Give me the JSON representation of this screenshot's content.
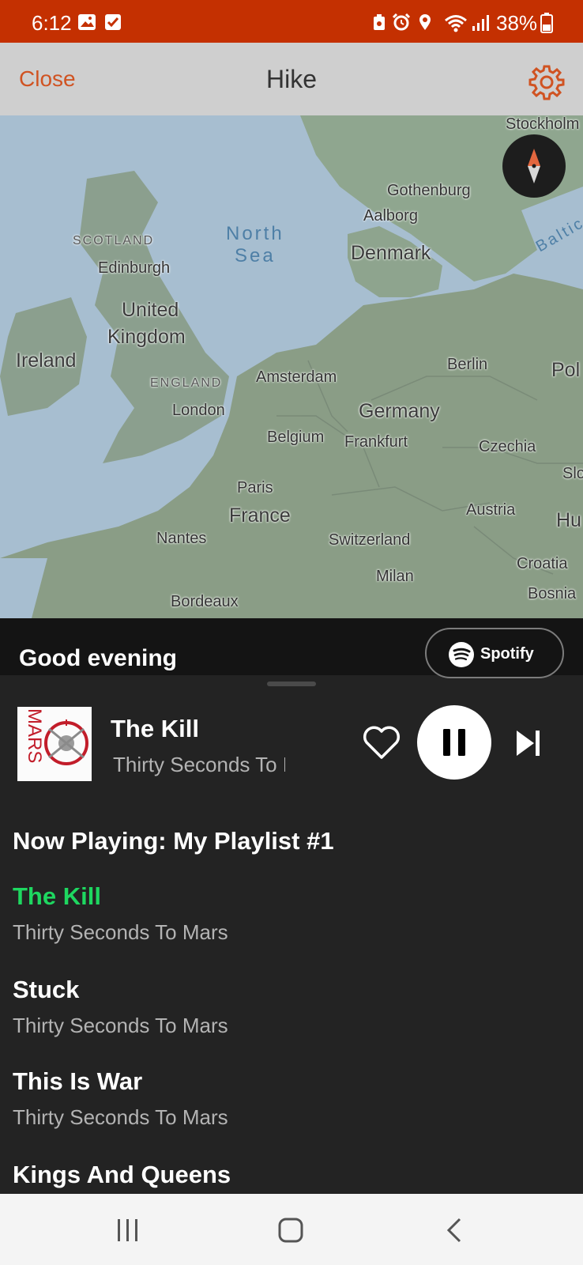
{
  "status_bar": {
    "time": "6:12",
    "battery": "38%",
    "icons": [
      "gallery-icon",
      "checkbox-icon",
      "battery-saver-icon",
      "alarm-icon",
      "location-icon",
      "wifi-icon",
      "signal-icon",
      "battery-icon"
    ]
  },
  "header": {
    "close_label": "Close",
    "title": "Hike",
    "settings_icon": "gear-icon"
  },
  "map": {
    "labels": {
      "stockholm": "Stockholm",
      "gothenburg": "Gothenburg",
      "aalborg": "Aalborg",
      "scotland": "SCOTLAND",
      "edinburgh": "Edinburgh",
      "north_sea_1": "North",
      "north_sea_2": "Sea",
      "denmark": "Denmark",
      "baltic": "Baltic",
      "uk_1": "United",
      "uk_2": "Kingdom",
      "ireland": "Ireland",
      "england": "ENGLAND",
      "amsterdam": "Amsterdam",
      "berlin": "Berlin",
      "poland": "Pol",
      "london": "London",
      "germany": "Germany",
      "belgium": "Belgium",
      "frankfurt": "Frankfurt",
      "czechia": "Czechia",
      "slovakia": "Slo",
      "paris": "Paris",
      "austria": "Austria",
      "france": "France",
      "hungary": "Hu",
      "nantes": "Nantes",
      "switzerland": "Switzerland",
      "croatia": "Croatia",
      "milan": "Milan",
      "bosnia": "Bosnia",
      "bordeaux": "Bordeaux"
    },
    "compass_icon": "compass-icon"
  },
  "spotify": {
    "greeting": "Good evening",
    "brand": "Spotify",
    "now_playing": {
      "title": "The Kill",
      "artist": "Thirty Seconds To Mars",
      "album_art_text": "MARS"
    },
    "playlist_header": "Now Playing: My Playlist #1",
    "tracks": [
      {
        "title": "The Kill",
        "artist": "Thirty Seconds To Mars",
        "active": true
      },
      {
        "title": "Stuck",
        "artist": "Thirty Seconds To Mars",
        "active": false
      },
      {
        "title": "This Is War",
        "artist": "Thirty Seconds To Mars",
        "active": false
      },
      {
        "title": "Kings And Queens",
        "artist": "",
        "active": false
      }
    ],
    "colors": {
      "accent": "#1ed760",
      "panel": "#232323"
    }
  },
  "colors": {
    "status_bar": "#c43001",
    "header": "#cfcfcf",
    "close_text": "#d05322"
  }
}
